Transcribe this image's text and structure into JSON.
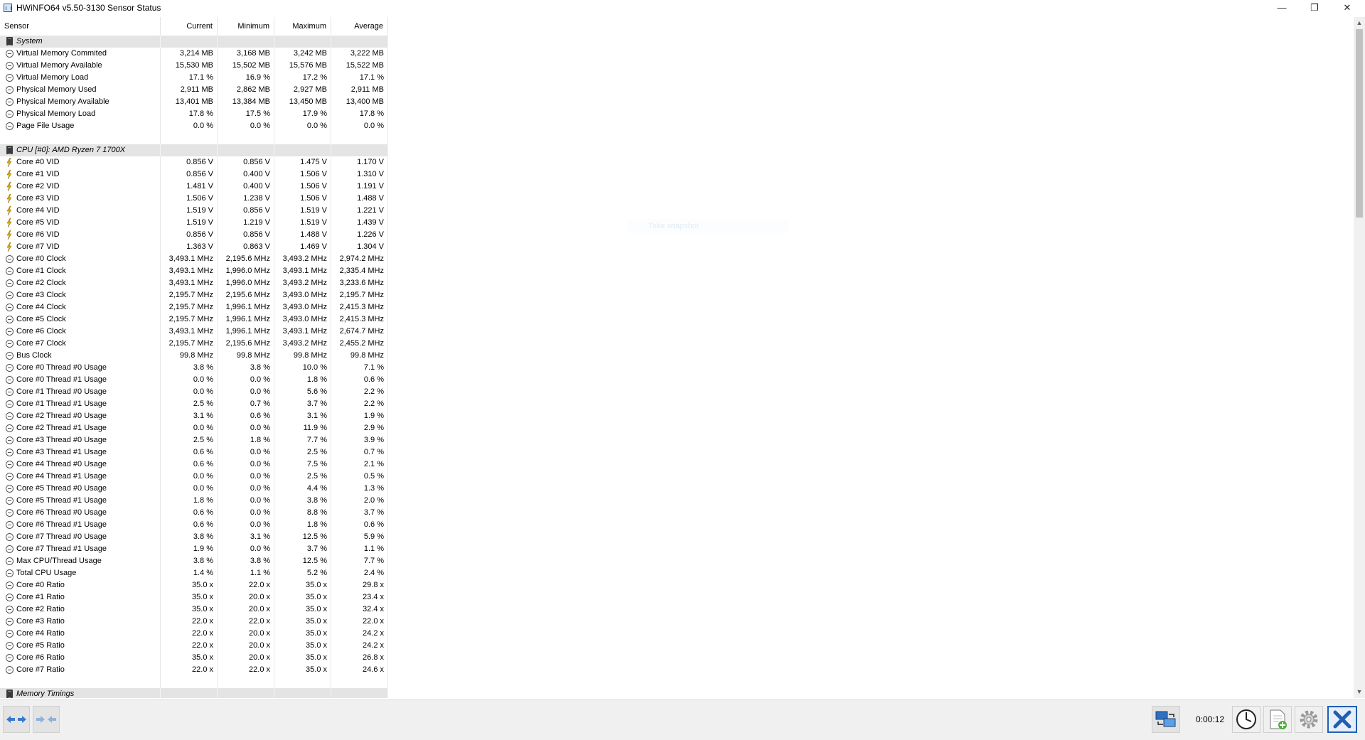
{
  "window": {
    "title": "HWiNFO64 v5.50-3130 Sensor Status",
    "minimize": "—",
    "maximize": "❐",
    "close": "✕"
  },
  "columns": [
    "Sensor",
    "Current",
    "Minimum",
    "Maximum",
    "Average"
  ],
  "ghost_text": "Take snapshot",
  "rows": [
    {
      "type": "group",
      "name": "System"
    },
    {
      "type": "sensor",
      "icon": "clock",
      "name": "Virtual Memory Commited",
      "cur": "3,214 MB",
      "min": "3,168 MB",
      "max": "3,242 MB",
      "avg": "3,222 MB"
    },
    {
      "type": "sensor",
      "icon": "clock",
      "name": "Virtual Memory Available",
      "cur": "15,530 MB",
      "min": "15,502 MB",
      "max": "15,576 MB",
      "avg": "15,522 MB"
    },
    {
      "type": "sensor",
      "icon": "clock",
      "name": "Virtual Memory Load",
      "cur": "17.1 %",
      "min": "16.9 %",
      "max": "17.2 %",
      "avg": "17.1 %"
    },
    {
      "type": "sensor",
      "icon": "clock",
      "name": "Physical Memory Used",
      "cur": "2,911 MB",
      "min": "2,862 MB",
      "max": "2,927 MB",
      "avg": "2,911 MB"
    },
    {
      "type": "sensor",
      "icon": "clock",
      "name": "Physical Memory Available",
      "cur": "13,401 MB",
      "min": "13,384 MB",
      "max": "13,450 MB",
      "avg": "13,400 MB"
    },
    {
      "type": "sensor",
      "icon": "clock",
      "name": "Physical Memory Load",
      "cur": "17.8 %",
      "min": "17.5 %",
      "max": "17.9 %",
      "avg": "17.8 %"
    },
    {
      "type": "sensor",
      "icon": "clock",
      "name": "Page File Usage",
      "cur": "0.0 %",
      "min": "0.0 %",
      "max": "0.0 %",
      "avg": "0.0 %"
    },
    {
      "type": "blank"
    },
    {
      "type": "group",
      "name": "CPU [#0]: AMD Ryzen 7 1700X"
    },
    {
      "type": "sensor",
      "icon": "bolt",
      "name": "Core #0 VID",
      "cur": "0.856 V",
      "min": "0.856 V",
      "max": "1.475 V",
      "avg": "1.170 V"
    },
    {
      "type": "sensor",
      "icon": "bolt",
      "name": "Core #1 VID",
      "cur": "0.856 V",
      "min": "0.400 V",
      "max": "1.506 V",
      "avg": "1.310 V"
    },
    {
      "type": "sensor",
      "icon": "bolt",
      "name": "Core #2 VID",
      "cur": "1.481 V",
      "min": "0.400 V",
      "max": "1.506 V",
      "avg": "1.191 V"
    },
    {
      "type": "sensor",
      "icon": "bolt",
      "name": "Core #3 VID",
      "cur": "1.506 V",
      "min": "1.238 V",
      "max": "1.506 V",
      "avg": "1.488 V"
    },
    {
      "type": "sensor",
      "icon": "bolt",
      "name": "Core #4 VID",
      "cur": "1.519 V",
      "min": "0.856 V",
      "max": "1.519 V",
      "avg": "1.221 V"
    },
    {
      "type": "sensor",
      "icon": "bolt",
      "name": "Core #5 VID",
      "cur": "1.519 V",
      "min": "1.219 V",
      "max": "1.519 V",
      "avg": "1.439 V"
    },
    {
      "type": "sensor",
      "icon": "bolt",
      "name": "Core #6 VID",
      "cur": "0.856 V",
      "min": "0.856 V",
      "max": "1.488 V",
      "avg": "1.226 V"
    },
    {
      "type": "sensor",
      "icon": "bolt",
      "name": "Core #7 VID",
      "cur": "1.363 V",
      "min": "0.863 V",
      "max": "1.469 V",
      "avg": "1.304 V"
    },
    {
      "type": "sensor",
      "icon": "clock",
      "name": "Core #0 Clock",
      "cur": "3,493.1 MHz",
      "min": "2,195.6 MHz",
      "max": "3,493.2 MHz",
      "avg": "2,974.2 MHz"
    },
    {
      "type": "sensor",
      "icon": "clock",
      "name": "Core #1 Clock",
      "cur": "3,493.1 MHz",
      "min": "1,996.0 MHz",
      "max": "3,493.1 MHz",
      "avg": "2,335.4 MHz"
    },
    {
      "type": "sensor",
      "icon": "clock",
      "name": "Core #2 Clock",
      "cur": "3,493.1 MHz",
      "min": "1,996.0 MHz",
      "max": "3,493.2 MHz",
      "avg": "3,233.6 MHz"
    },
    {
      "type": "sensor",
      "icon": "clock",
      "name": "Core #3 Clock",
      "cur": "2,195.7 MHz",
      "min": "2,195.6 MHz",
      "max": "3,493.0 MHz",
      "avg": "2,195.7 MHz"
    },
    {
      "type": "sensor",
      "icon": "clock",
      "name": "Core #4 Clock",
      "cur": "2,195.7 MHz",
      "min": "1,996.1 MHz",
      "max": "3,493.0 MHz",
      "avg": "2,415.3 MHz"
    },
    {
      "type": "sensor",
      "icon": "clock",
      "name": "Core #5 Clock",
      "cur": "2,195.7 MHz",
      "min": "1,996.1 MHz",
      "max": "3,493.0 MHz",
      "avg": "2,415.3 MHz"
    },
    {
      "type": "sensor",
      "icon": "clock",
      "name": "Core #6 Clock",
      "cur": "3,493.1 MHz",
      "min": "1,996.1 MHz",
      "max": "3,493.1 MHz",
      "avg": "2,674.7 MHz"
    },
    {
      "type": "sensor",
      "icon": "clock",
      "name": "Core #7 Clock",
      "cur": "2,195.7 MHz",
      "min": "2,195.6 MHz",
      "max": "3,493.2 MHz",
      "avg": "2,455.2 MHz"
    },
    {
      "type": "sensor",
      "icon": "clock",
      "name": "Bus Clock",
      "cur": "99.8 MHz",
      "min": "99.8 MHz",
      "max": "99.8 MHz",
      "avg": "99.8 MHz"
    },
    {
      "type": "sensor",
      "icon": "clock",
      "name": "Core #0 Thread #0 Usage",
      "cur": "3.8 %",
      "min": "3.8 %",
      "max": "10.0 %",
      "avg": "7.1 %"
    },
    {
      "type": "sensor",
      "icon": "clock",
      "name": "Core #0 Thread #1 Usage",
      "cur": "0.0 %",
      "min": "0.0 %",
      "max": "1.8 %",
      "avg": "0.6 %"
    },
    {
      "type": "sensor",
      "icon": "clock",
      "name": "Core #1 Thread #0 Usage",
      "cur": "0.0 %",
      "min": "0.0 %",
      "max": "5.6 %",
      "avg": "2.2 %"
    },
    {
      "type": "sensor",
      "icon": "clock",
      "name": "Core #1 Thread #1 Usage",
      "cur": "2.5 %",
      "min": "0.7 %",
      "max": "3.7 %",
      "avg": "2.2 %"
    },
    {
      "type": "sensor",
      "icon": "clock",
      "name": "Core #2 Thread #0 Usage",
      "cur": "3.1 %",
      "min": "0.6 %",
      "max": "3.1 %",
      "avg": "1.9 %"
    },
    {
      "type": "sensor",
      "icon": "clock",
      "name": "Core #2 Thread #1 Usage",
      "cur": "0.0 %",
      "min": "0.0 %",
      "max": "11.9 %",
      "avg": "2.9 %"
    },
    {
      "type": "sensor",
      "icon": "clock",
      "name": "Core #3 Thread #0 Usage",
      "cur": "2.5 %",
      "min": "1.8 %",
      "max": "7.7 %",
      "avg": "3.9 %"
    },
    {
      "type": "sensor",
      "icon": "clock",
      "name": "Core #3 Thread #1 Usage",
      "cur": "0.6 %",
      "min": "0.0 %",
      "max": "2.5 %",
      "avg": "0.7 %"
    },
    {
      "type": "sensor",
      "icon": "clock",
      "name": "Core #4 Thread #0 Usage",
      "cur": "0.6 %",
      "min": "0.0 %",
      "max": "7.5 %",
      "avg": "2.1 %"
    },
    {
      "type": "sensor",
      "icon": "clock",
      "name": "Core #4 Thread #1 Usage",
      "cur": "0.0 %",
      "min": "0.0 %",
      "max": "2.5 %",
      "avg": "0.5 %"
    },
    {
      "type": "sensor",
      "icon": "clock",
      "name": "Core #5 Thread #0 Usage",
      "cur": "0.0 %",
      "min": "0.0 %",
      "max": "4.4 %",
      "avg": "1.3 %"
    },
    {
      "type": "sensor",
      "icon": "clock",
      "name": "Core #5 Thread #1 Usage",
      "cur": "1.8 %",
      "min": "0.0 %",
      "max": "3.8 %",
      "avg": "2.0 %"
    },
    {
      "type": "sensor",
      "icon": "clock",
      "name": "Core #6 Thread #0 Usage",
      "cur": "0.6 %",
      "min": "0.0 %",
      "max": "8.8 %",
      "avg": "3.7 %"
    },
    {
      "type": "sensor",
      "icon": "clock",
      "name": "Core #6 Thread #1 Usage",
      "cur": "0.6 %",
      "min": "0.0 %",
      "max": "1.8 %",
      "avg": "0.6 %"
    },
    {
      "type": "sensor",
      "icon": "clock",
      "name": "Core #7 Thread #0 Usage",
      "cur": "3.8 %",
      "min": "3.1 %",
      "max": "12.5 %",
      "avg": "5.9 %"
    },
    {
      "type": "sensor",
      "icon": "clock",
      "name": "Core #7 Thread #1 Usage",
      "cur": "1.9 %",
      "min": "0.0 %",
      "max": "3.7 %",
      "avg": "1.1 %"
    },
    {
      "type": "sensor",
      "icon": "clock",
      "name": "Max CPU/Thread Usage",
      "cur": "3.8 %",
      "min": "3.8 %",
      "max": "12.5 %",
      "avg": "7.7 %"
    },
    {
      "type": "sensor",
      "icon": "clock",
      "name": "Total CPU Usage",
      "cur": "1.4 %",
      "min": "1.1 %",
      "max": "5.2 %",
      "avg": "2.4 %"
    },
    {
      "type": "sensor",
      "icon": "clock",
      "name": "Core #0 Ratio",
      "cur": "35.0 x",
      "min": "22.0 x",
      "max": "35.0 x",
      "avg": "29.8 x"
    },
    {
      "type": "sensor",
      "icon": "clock",
      "name": "Core #1 Ratio",
      "cur": "35.0 x",
      "min": "20.0 x",
      "max": "35.0 x",
      "avg": "23.4 x"
    },
    {
      "type": "sensor",
      "icon": "clock",
      "name": "Core #2 Ratio",
      "cur": "35.0 x",
      "min": "20.0 x",
      "max": "35.0 x",
      "avg": "32.4 x"
    },
    {
      "type": "sensor",
      "icon": "clock",
      "name": "Core #3 Ratio",
      "cur": "22.0 x",
      "min": "22.0 x",
      "max": "35.0 x",
      "avg": "22.0 x"
    },
    {
      "type": "sensor",
      "icon": "clock",
      "name": "Core #4 Ratio",
      "cur": "22.0 x",
      "min": "20.0 x",
      "max": "35.0 x",
      "avg": "24.2 x"
    },
    {
      "type": "sensor",
      "icon": "clock",
      "name": "Core #5 Ratio",
      "cur": "22.0 x",
      "min": "20.0 x",
      "max": "35.0 x",
      "avg": "24.2 x"
    },
    {
      "type": "sensor",
      "icon": "clock",
      "name": "Core #6 Ratio",
      "cur": "35.0 x",
      "min": "20.0 x",
      "max": "35.0 x",
      "avg": "26.8 x"
    },
    {
      "type": "sensor",
      "icon": "clock",
      "name": "Core #7 Ratio",
      "cur": "22.0 x",
      "min": "22.0 x",
      "max": "35.0 x",
      "avg": "24.6 x"
    },
    {
      "type": "blank"
    },
    {
      "type": "group",
      "name": "Memory Timings"
    }
  ],
  "statusbar": {
    "timer": "0:00:12",
    "buttons": [
      "nav-expand-icon",
      "nav-collapse-icon",
      "network-icon",
      "clock-icon",
      "add-report-icon",
      "gear-icon",
      "close-icon"
    ]
  },
  "colors": {
    "group_bg": "#e4e4e4",
    "close_blue": "#1e5fb3",
    "arrow_blue": "#3a78c9"
  }
}
